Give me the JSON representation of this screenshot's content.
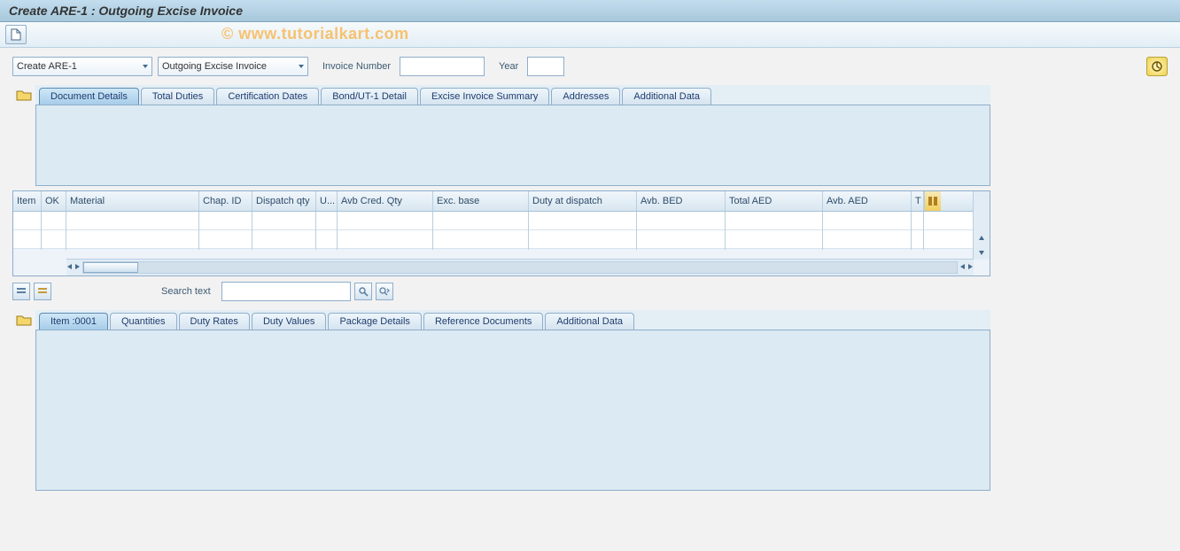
{
  "title": "Create ARE-1 : Outgoing Excise Invoice",
  "watermark": "© www.tutorialkart.com",
  "selects": {
    "action": "Create ARE-1",
    "doc_type": "Outgoing Excise Invoice"
  },
  "fields": {
    "invoice_label": "Invoice Number",
    "invoice_value": "",
    "year_label": "Year",
    "year_value": ""
  },
  "upper_tabs": [
    "Document Details",
    "Total Duties",
    "Certification Dates",
    "Bond/UT-1 Detail",
    "Excise Invoice Summary",
    "Addresses",
    "Additional Data"
  ],
  "table": {
    "columns": [
      "Item",
      "OK",
      "Material",
      "Chap. ID",
      "Dispatch qty",
      "U...",
      "Avb Cred. Qty",
      "Exc. base",
      "Duty at dispatch",
      "Avb. BED",
      "Total AED",
      "Avb. AED",
      "T"
    ]
  },
  "search": {
    "label": "Search text",
    "value": ""
  },
  "lower_tabs": [
    "Item  :0001",
    "Quantities",
    "Duty Rates",
    "Duty Values",
    "Package Details",
    "Reference Documents",
    "Additional Data"
  ]
}
